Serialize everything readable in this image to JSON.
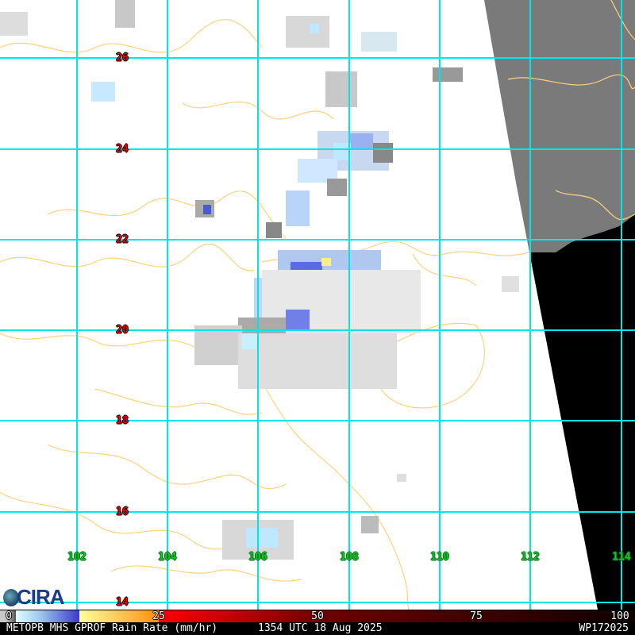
{
  "map": {
    "lat_labels": [
      "26",
      "24",
      "22",
      "20",
      "18",
      "16",
      "14"
    ],
    "lon_labels": [
      "102",
      "104",
      "106",
      "108",
      "110",
      "112",
      "114"
    ],
    "colors": {
      "grid": "#00e5e5",
      "border": "#ffd27a",
      "lat_label": "#e00000",
      "lon_label": "#11cc11",
      "no_data": "#000000",
      "land_out_of_swath": "#7a7a7a"
    }
  },
  "logo": {
    "text": "CIRA"
  },
  "colorbar": {
    "ticks": [
      "0",
      "25",
      "50",
      "75",
      "100"
    ]
  },
  "footer": {
    "product": "METOPB MHS GPROF Rain Rate (mm/hr)",
    "time": "1354 UTC 18 Aug 2025",
    "storm_id": "WP172025"
  }
}
